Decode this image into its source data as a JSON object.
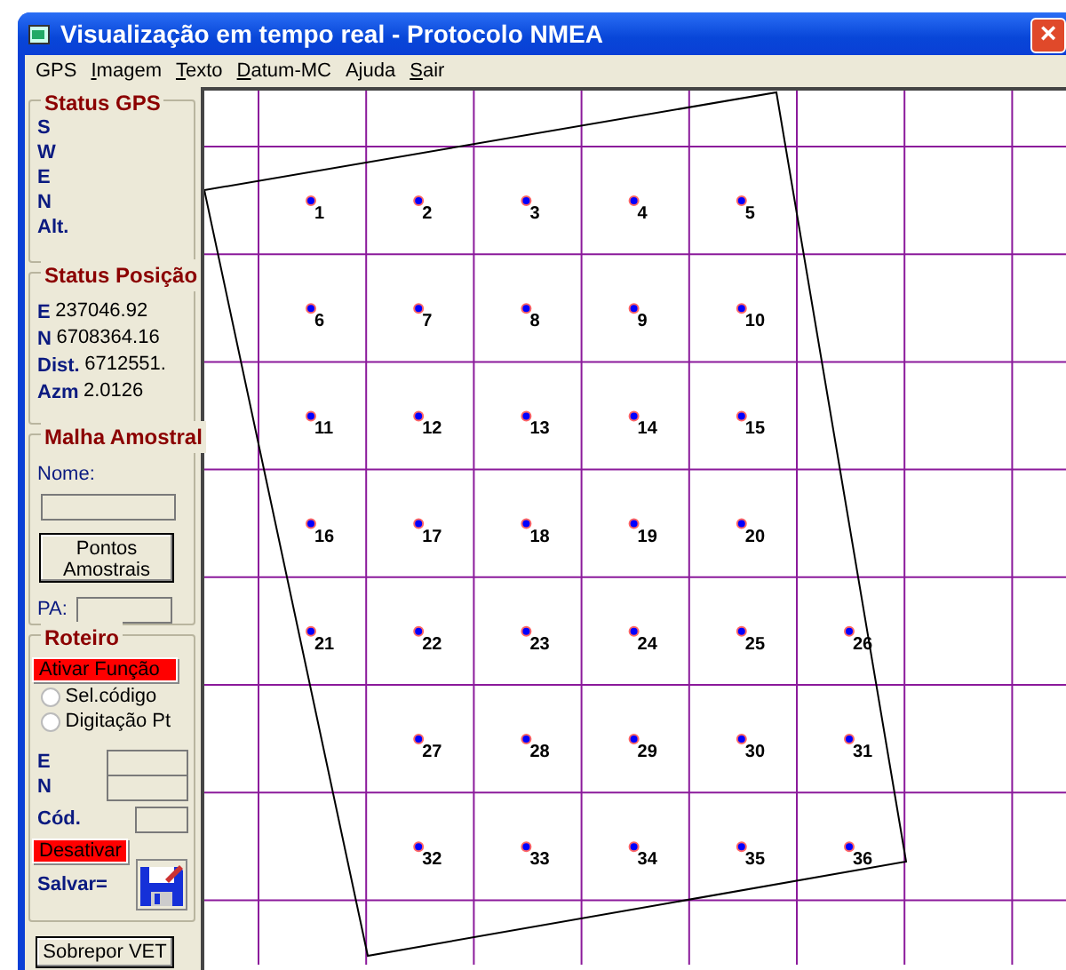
{
  "window": {
    "title": "Visualização em tempo real - Protocolo NMEA",
    "close": "×"
  },
  "menu": [
    {
      "label": "GPS",
      "mnemonic": false
    },
    {
      "label": "Imagem",
      "mnemonic": true
    },
    {
      "label": "Texto",
      "mnemonic": true
    },
    {
      "label": "Datum-MC",
      "mnemonic": true
    },
    {
      "label": "Ajuda",
      "mnemonic": false
    },
    {
      "label": "Sair",
      "mnemonic": true
    }
  ],
  "status_gps": {
    "title": "Status GPS",
    "items": [
      "S",
      "W",
      "E",
      "N",
      "Alt."
    ]
  },
  "status_posicao": {
    "title": "Status Posição",
    "items": [
      {
        "label": "E",
        "value": "237046.92"
      },
      {
        "label": "N",
        "value": "6708364.16"
      },
      {
        "label": "Dist.",
        "value": "6712551."
      },
      {
        "label": "Azm",
        "value": "2.0126"
      }
    ]
  },
  "malha_amostral": {
    "title": "Malha Amostral",
    "name_label": "Nome:",
    "points_button": "Pontos Amostrais",
    "pa_label": "PA:"
  },
  "roteiro": {
    "title": "Roteiro",
    "activate_button": "Ativar Função",
    "options": [
      {
        "label": "Sel.código",
        "selected": false
      },
      {
        "label": "Digitação Pt",
        "selected": false
      }
    ],
    "e_label": "E",
    "n_label": "N",
    "code_label": "Cód.",
    "deactivate_button": "Desativar",
    "save_label": "Salvar="
  },
  "overlay_button": "Sobrepor VET",
  "sample_grid": [
    [
      {
        "kind": "point",
        "label": "1"
      },
      {
        "kind": "point",
        "label": "2"
      },
      {
        "kind": "point",
        "label": "3"
      },
      {
        "kind": "point",
        "label": "4"
      },
      {
        "kind": "point",
        "label": "5"
      }
    ],
    [
      {
        "kind": "point",
        "label": "6"
      },
      {
        "kind": "point",
        "label": "7"
      },
      {
        "kind": "point",
        "label": "8"
      },
      {
        "kind": "point",
        "label": "9"
      },
      {
        "kind": "point",
        "label": "10"
      }
    ],
    [
      {
        "kind": "point",
        "label": "11"
      },
      {
        "kind": "point",
        "label": "12"
      },
      {
        "kind": "point",
        "label": "13"
      },
      {
        "kind": "point",
        "label": "14"
      },
      {
        "kind": "point",
        "label": "15"
      }
    ],
    [
      {
        "kind": "point",
        "label": "16"
      },
      {
        "kind": "point",
        "label": "17"
      },
      {
        "kind": "point",
        "label": "18"
      },
      {
        "kind": "point",
        "label": "19"
      },
      {
        "kind": "point",
        "label": "20"
      }
    ],
    [
      {
        "kind": "point",
        "label": "21"
      },
      {
        "kind": "point",
        "label": "22"
      },
      {
        "kind": "point",
        "label": "23"
      },
      {
        "kind": "point",
        "label": "24"
      },
      {
        "kind": "point",
        "label": "25"
      },
      {
        "kind": "point",
        "label": "26"
      }
    ],
    [
      {
        "kind": "blank"
      },
      {
        "kind": "point",
        "label": "27"
      },
      {
        "kind": "point",
        "label": "28"
      },
      {
        "kind": "point",
        "label": "29"
      },
      {
        "kind": "point",
        "label": "30"
      },
      {
        "kind": "point",
        "label": "31"
      }
    ],
    [
      {
        "kind": "blank"
      },
      {
        "kind": "point",
        "label": "32"
      },
      {
        "kind": "point",
        "label": "33"
      },
      {
        "kind": "point",
        "label": "34"
      },
      {
        "kind": "point",
        "label": "35"
      },
      {
        "kind": "point",
        "label": "36"
      }
    ]
  ]
}
